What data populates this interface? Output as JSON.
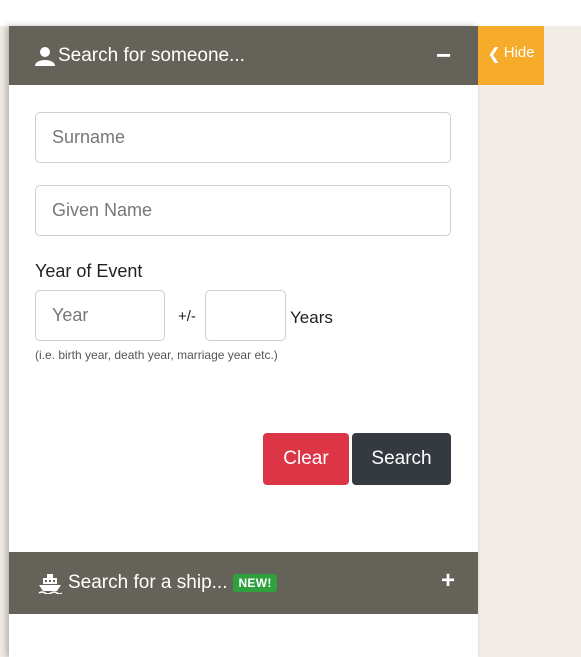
{
  "person_search": {
    "title": "Search for someone...",
    "toggle_symbol": "−",
    "surname_placeholder": "Surname",
    "given_name_placeholder": "Given Name",
    "year_label": "Year of Event",
    "year_placeholder": "Year",
    "plus_minus": "+/-",
    "years_label": "Years",
    "hint": "(i.e. birth year, death year, marriage year etc.)",
    "clear_label": "Clear",
    "search_label": "Search"
  },
  "ship_search": {
    "title": "Search for a ship...",
    "badge": "NEW!",
    "toggle_symbol": "+"
  },
  "hide_button": {
    "label": "Hide",
    "chevron": "❮"
  },
  "colors": {
    "header_bg": "#656259",
    "clear_button": "#dc3545",
    "search_button": "#343a40",
    "hide_button": "#f6ab2a",
    "new_badge": "#2ea03d",
    "page_bg": "#f1ede6"
  },
  "icons": {
    "person_header": "person-icon",
    "ship_header": "ship-icon",
    "hide": "chevron-left-icon"
  }
}
